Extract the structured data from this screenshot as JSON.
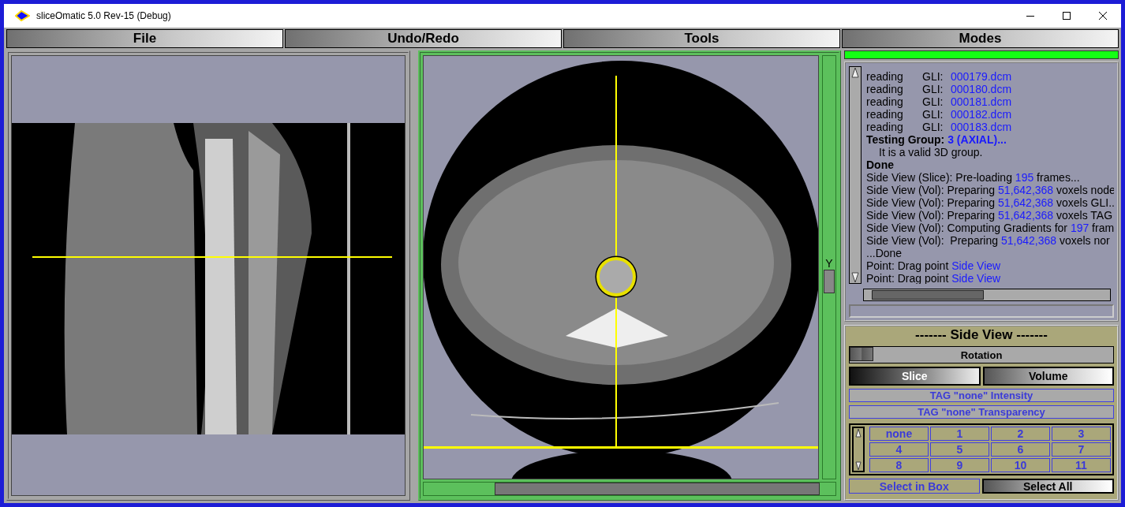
{
  "window": {
    "title": "sliceOmatic 5.0 Rev-15 (Debug)"
  },
  "menu": [
    "File",
    "Undo/Redo",
    "Tools",
    "Modes"
  ],
  "views": [
    {
      "kind": "sagittal",
      "selected": false
    },
    {
      "kind": "axial",
      "selected": true,
      "axis_label": "Y"
    }
  ],
  "progress": {
    "level": 1
  },
  "log": {
    "lines": [
      {
        "kind": "file",
        "parts": [
          {
            "text": "reading",
            "highlight": false
          },
          {
            "text": "GLI:",
            "highlight": false
          },
          {
            "text": "000179.dcm",
            "highlight": true
          }
        ]
      },
      {
        "kind": "file",
        "parts": [
          {
            "text": "reading",
            "highlight": false
          },
          {
            "text": "GLI:",
            "highlight": false
          },
          {
            "text": "000180.dcm",
            "highlight": true
          }
        ]
      },
      {
        "kind": "file",
        "parts": [
          {
            "text": "reading",
            "highlight": false
          },
          {
            "text": "GLI:",
            "highlight": false
          },
          {
            "text": "000181.dcm",
            "highlight": true
          }
        ]
      },
      {
        "kind": "file",
        "parts": [
          {
            "text": "reading",
            "highlight": false
          },
          {
            "text": "GLI:",
            "highlight": false
          },
          {
            "text": "000182.dcm",
            "highlight": true
          }
        ]
      },
      {
        "kind": "file",
        "parts": [
          {
            "text": "reading",
            "highlight": false
          },
          {
            "text": "GLI:",
            "highlight": false
          },
          {
            "text": "000183.dcm",
            "highlight": true
          }
        ]
      },
      {
        "kind": "heading",
        "parts": [
          {
            "text": "Testing Group: ",
            "highlight": false
          },
          {
            "text": "3 (AXIAL)...",
            "highlight": true
          }
        ]
      },
      {
        "kind": "note",
        "parts": [
          {
            "text": "It is a valid 3D group.",
            "highlight": false
          }
        ]
      },
      {
        "kind": "heading",
        "parts": [
          {
            "text": "Done",
            "highlight": false
          }
        ]
      },
      {
        "kind": "plain",
        "parts": [
          {
            "text": "Side View (Slice): Pre-loading ",
            "highlight": false
          },
          {
            "text": "195",
            "highlight": true
          },
          {
            "text": " frames...",
            "highlight": false
          }
        ]
      },
      {
        "kind": "plain",
        "parts": [
          {
            "text": "Side View (Vol): Preparing ",
            "highlight": false
          },
          {
            "text": "51,642,368",
            "highlight": true
          },
          {
            "text": " voxels node",
            "highlight": false
          }
        ]
      },
      {
        "kind": "plain",
        "parts": [
          {
            "text": "Side View (Vol): Preparing ",
            "highlight": false
          },
          {
            "text": "51,642,368",
            "highlight": true
          },
          {
            "text": " voxels GLI..",
            "highlight": false
          }
        ]
      },
      {
        "kind": "plain",
        "parts": [
          {
            "text": "Side View (Vol): Preparing ",
            "highlight": false
          },
          {
            "text": "51,642,368",
            "highlight": true
          },
          {
            "text": " voxels TAG",
            "highlight": false
          }
        ]
      },
      {
        "kind": "plain",
        "parts": [
          {
            "text": "Side View (Vol): Computing Gradients for ",
            "highlight": false
          },
          {
            "text": "197",
            "highlight": true
          },
          {
            "text": " fram",
            "highlight": false
          }
        ]
      },
      {
        "kind": "plain",
        "parts": [
          {
            "text": "Side View (Vol):  Preparing ",
            "highlight": false
          },
          {
            "text": "51,642,368",
            "highlight": true
          },
          {
            "text": " voxels nor",
            "highlight": false
          }
        ]
      },
      {
        "kind": "plain",
        "parts": [
          {
            "text": "...Done",
            "highlight": false
          }
        ]
      },
      {
        "kind": "plain",
        "parts": [
          {
            "text": "Point: Drag point ",
            "highlight": false
          },
          {
            "text": "Side View",
            "highlight": true
          }
        ]
      },
      {
        "kind": "plain",
        "parts": [
          {
            "text": "Point: Drag point ",
            "highlight": false
          },
          {
            "text": "Side View",
            "highlight": true
          }
        ]
      }
    ]
  },
  "side_view": {
    "title": "------- Side View -------",
    "slider": {
      "label": "Rotation",
      "level": 0
    },
    "tabs": [
      {
        "label": "Slice",
        "selected": true
      },
      {
        "label": "Volume",
        "selected": false
      }
    ],
    "bars": [
      "TAG \"none\" Intensity",
      "TAG \"none\" Transparency"
    ],
    "tags": [
      "none",
      "1",
      "2",
      "3",
      "4",
      "5",
      "6",
      "7",
      "8",
      "9",
      "10",
      "11"
    ],
    "actions": [
      {
        "label": "Select in Box",
        "kind": "flat"
      },
      {
        "label": "Select All",
        "kind": "raised"
      }
    ]
  }
}
